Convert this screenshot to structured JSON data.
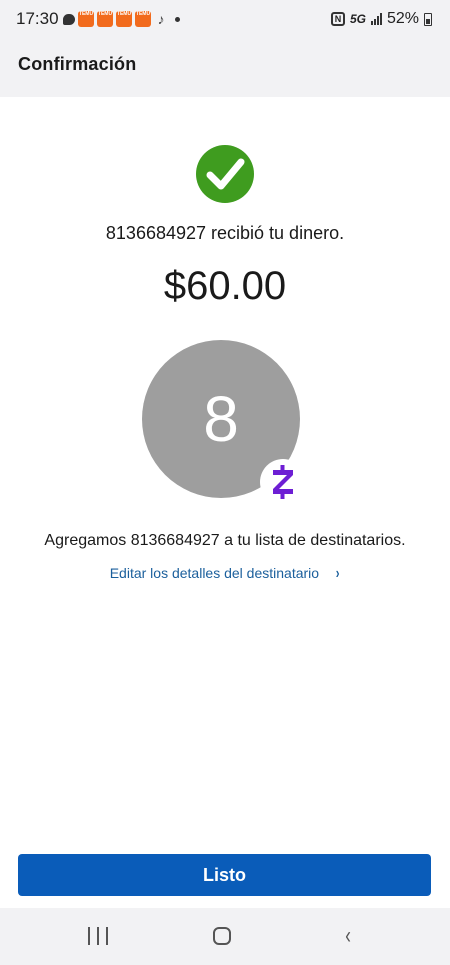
{
  "status_bar": {
    "time": "17:30",
    "network": "5G",
    "battery": "52%",
    "nfc": "N",
    "temu_label": "TEMU",
    "tiktok_glyph": "♪"
  },
  "header": {
    "title": "Confirmación"
  },
  "confirmation": {
    "success_icon": "check-circle-icon",
    "message": "8136684927 recibió tu dinero.",
    "amount": "$60.00",
    "avatar_initial": "8",
    "zelle_symbol": "Z"
  },
  "recipient": {
    "added_message": "Agregamos 8136684927 a tu lista de destinatarios.",
    "edit_link": "Editar los detalles del destinatario",
    "edit_chevron": "›"
  },
  "actions": {
    "done_label": "Listo"
  },
  "nav_bar": {
    "back_glyph": "‹"
  },
  "colors": {
    "success_green": "#3f9c1f",
    "primary_blue": "#0a5cb9",
    "link_blue": "#1b5f9c",
    "zelle_purple": "#6d1ed4",
    "avatar_gray": "#9e9e9e"
  }
}
